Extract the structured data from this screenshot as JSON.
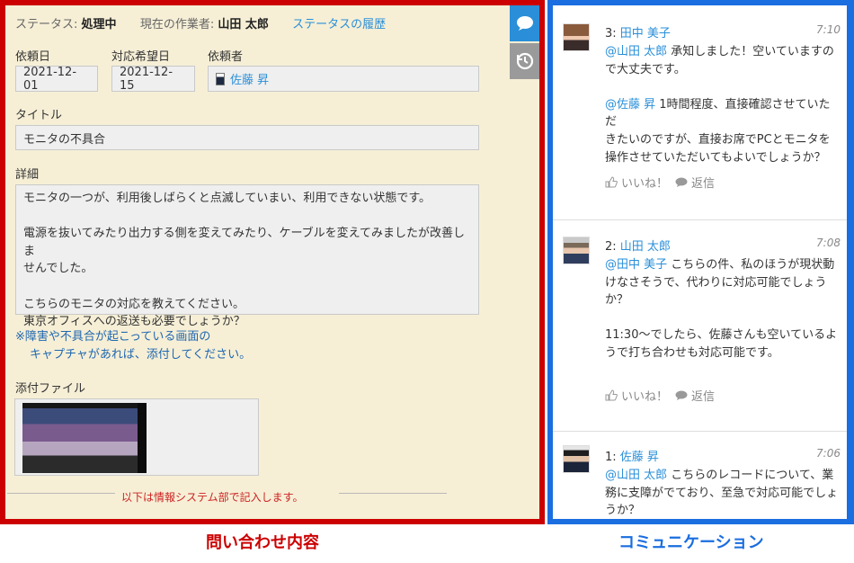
{
  "status": {
    "label": "ステータス:",
    "value": "処理中",
    "assignee_label": "現在の作業者:",
    "assignee": "山田 太郎",
    "history_link": "ステータスの履歴"
  },
  "form": {
    "request_date": {
      "label": "依頼日",
      "value": "2021-12-01"
    },
    "desired_date": {
      "label": "対応希望日",
      "value": "2021-12-15"
    },
    "requester": {
      "label": "依頼者",
      "value": "佐藤 昇"
    },
    "title": {
      "label": "タイトル",
      "value": "モニタの不具合"
    },
    "detail": {
      "label": "詳細",
      "lines": [
        "モニタの一つが、利用後しばらくと点滅していまい、利用できない状態です。",
        "",
        "電源を抜いてみたり出力する側を変えてみたり、ケーブルを変えてみましたが改善しま",
        "せんでした。",
        "",
        "こちらのモニタの対応を教えてください。",
        "東京オフィスへの返送も必要でしょうか？"
      ]
    },
    "note": {
      "line1": "※障害や不具合が起こっている画面の",
      "line2": "キャプチャがあれば、添付してください。"
    },
    "attachment_label": "添付ファイル",
    "section_divider": "以下は情報システム部で記入します。"
  },
  "captions": {
    "left": "問い合わせ内容",
    "right": "コミュニケーション"
  },
  "comments": [
    {
      "number": "3:",
      "author": "田中 美子",
      "time": "7:10",
      "lines": [
        [
          {
            "m": "@山田 太郎"
          },
          {
            "t": " 承知しました！空いていますの"
          }
        ],
        [
          {
            "t": "で大丈夫です。"
          }
        ],
        [],
        [
          {
            "m": "@佐藤 昇"
          },
          {
            "t": " 1時間程度、直接確認させていただ"
          }
        ],
        [
          {
            "t": "きたいのですが、直接お席でPCとモニタを"
          }
        ],
        [
          {
            "t": "操作させていただいてもよいでしょうか？"
          }
        ]
      ],
      "like": "いいね！",
      "reply": "返信"
    },
    {
      "number": "2:",
      "author": "山田 太郎",
      "time": "7:08",
      "lines": [
        [
          {
            "m": "@田中 美子"
          },
          {
            "t": " こちらの件、私のほうが現状動"
          }
        ],
        [
          {
            "t": "けなさそうで、代わりに対応可能でしょう"
          }
        ],
        [
          {
            "t": "か？"
          }
        ],
        [],
        [
          {
            "t": "11:30〜でしたら、佐藤さんも空いているよ"
          }
        ],
        [
          {
            "t": "うで打ち合わせも対応可能です。"
          }
        ]
      ],
      "like": "いいね！",
      "reply": "返信"
    },
    {
      "number": "1:",
      "author": "佐藤 昇",
      "time": "7:06",
      "lines": [
        [
          {
            "m": "@山田 太郎"
          },
          {
            "t": " こちらのレコードについて、業"
          }
        ],
        [
          {
            "t": "務に支障がでており、至急で対応可能でしょ"
          }
        ],
        [
          {
            "t": "うか？"
          }
        ]
      ]
    }
  ],
  "colors": {
    "left_frame": "#cc0000",
    "right_frame": "#1a6ee0",
    "left_bg": "#f6efd6",
    "link": "#2a8fd8",
    "note": "#2067b0"
  },
  "icons": [
    "speech-bubble-icon",
    "history-clock-icon",
    "user-icon",
    "thumbs-up-icon",
    "reply-bubble-icon"
  ]
}
